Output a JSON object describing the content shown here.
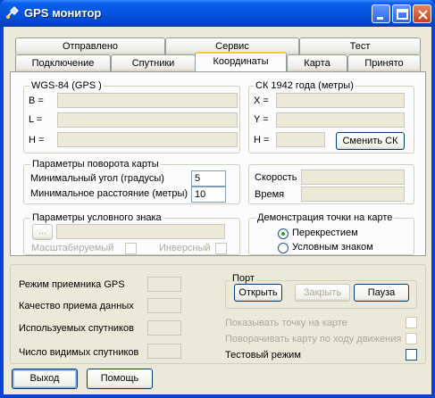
{
  "window": {
    "title": "GPS монитор"
  },
  "tabs_row1": [
    "Отправлено",
    "Сервис",
    "Тест"
  ],
  "tabs_row2": [
    "Подключение",
    "Спутники",
    "Координаты",
    "Карта",
    "Принято"
  ],
  "wgs": {
    "title": "WGS-84 (GPS )",
    "b": "B =",
    "l": "L =",
    "h": "H ="
  },
  "sk": {
    "title": "СК 1942 года (метры)",
    "x": "X =",
    "y": "Y =",
    "h": "H =",
    "change_button": "Сменить СК"
  },
  "rotation": {
    "title": "Параметры поворота карты",
    "min_angle_label": "Минимальный угол (градусы)",
    "min_angle_value": "5",
    "min_distance_label": "Минимальное расстояние (метры)",
    "min_distance_value": "10"
  },
  "speed": {
    "speed_label": "Скорость",
    "time_label": "Время"
  },
  "symbol": {
    "title": "Параметры условного знака",
    "browse_button": "...",
    "scalable": "Масштабируемый",
    "inverse": "Инверсный"
  },
  "demo": {
    "title": "Демонстрация точки на карте",
    "opt1": "Перекрестием",
    "opt2": "Условным знаком",
    "selected": "Перекрестием"
  },
  "status": {
    "gps_mode": "Режим приемника GPS",
    "quality": "Качество приема данных",
    "used_sats": "Используемых спутников",
    "visible_sats": "Число видимых спутников"
  },
  "port": {
    "title": "Порт",
    "open": "Открыть",
    "close": "Закрыть",
    "pause": "Пауза"
  },
  "options": {
    "show_point": "Показывать точку на карте",
    "rotate_map": "Поворачивать карту по ходу движения",
    "test_mode": "Тестовый режим"
  },
  "footer": {
    "exit": "Выход",
    "help": "Помощь"
  }
}
